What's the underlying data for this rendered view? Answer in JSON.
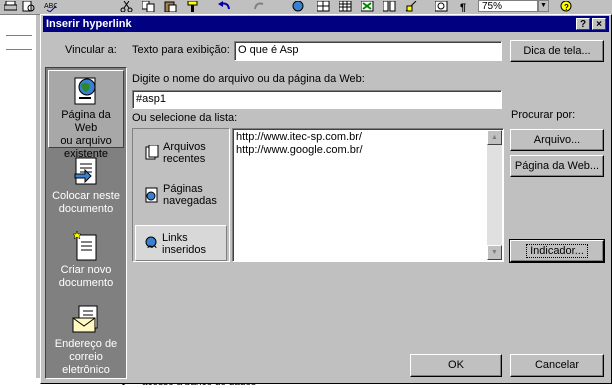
{
  "background": {
    "zoom": "75%",
    "doc_bottom_text": "acesso a banco de dados"
  },
  "dialog": {
    "title": "Inserir hyperlink",
    "help_button": "?",
    "close_button": "×",
    "link_to_label": "Vincular a:",
    "display_text_label": "Texto para exibição:",
    "display_text_value": "O que é Asp",
    "tooltip_button": "Dica de tela...",
    "address_label": "Digite o nome do arquivo ou da página da Web:",
    "address_value": "#asp1",
    "select_list_label": "Ou selecione da lista:",
    "browse_label": "Procurar por:",
    "file_button": "Arquivo...",
    "webpage_button": "Página da Web...",
    "bookmark_button": "Indicador...",
    "ok_button": "OK",
    "cancel_button": "Cancelar"
  },
  "link_bar": [
    {
      "l1": "Página da Web",
      "l2": "ou arquivo",
      "l3": "existente",
      "icon": "web-page-icon",
      "selected": true
    },
    {
      "l1": "Colocar neste",
      "l2": "documento",
      "l3": "",
      "icon": "place-in-document-icon",
      "selected": false
    },
    {
      "l1": "Criar novo",
      "l2": "documento",
      "l3": "",
      "icon": "new-document-icon",
      "selected": false
    },
    {
      "l1": "Endereço de",
      "l2": "correio",
      "l3": "eletrônico",
      "icon": "email-icon",
      "selected": false
    }
  ],
  "source_list": [
    {
      "l1": "Arquivos",
      "l2": "recentes",
      "icon": "recent-files-icon",
      "selected": false
    },
    {
      "l1": "Páginas",
      "l2": "navegadas",
      "icon": "browsed-pages-icon",
      "selected": false
    },
    {
      "l1": "Links",
      "l2": "inseridos",
      "icon": "inserted-links-icon",
      "selected": true
    }
  ],
  "links": [
    "http://www.itec-sp.com.br/",
    "http://www.google.com.br/"
  ],
  "colors": {
    "title_bar": "#000080",
    "link_bar": "#808080",
    "face": "#c0c0c0"
  }
}
